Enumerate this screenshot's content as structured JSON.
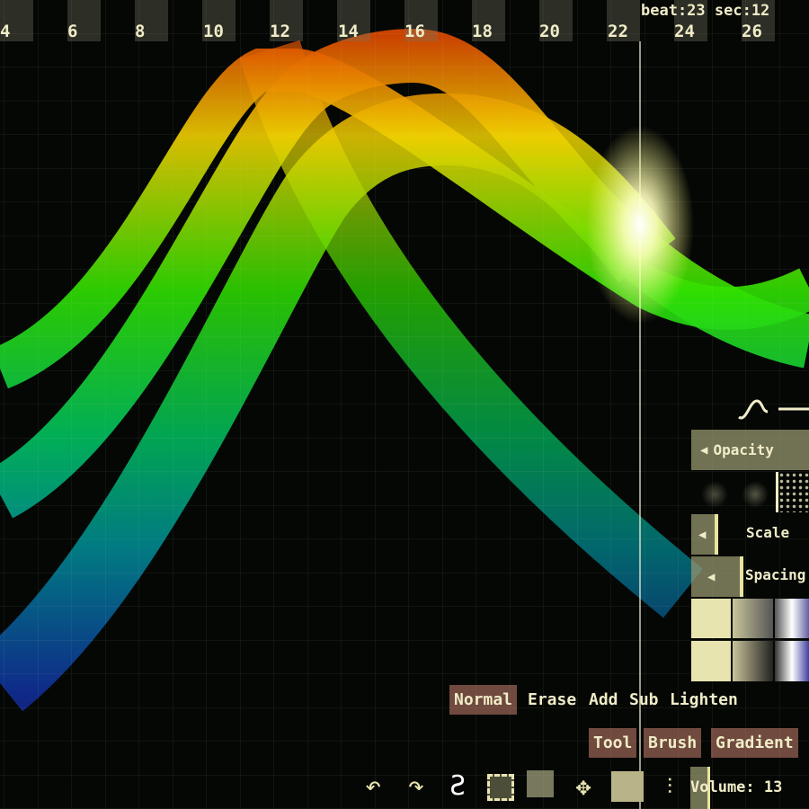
{
  "ruler": {
    "labels": [
      "4",
      "6",
      "8",
      "10",
      "12",
      "14",
      "16",
      "18",
      "20",
      "22",
      "24",
      "26"
    ],
    "beat_readout": "beat:23 sec:12"
  },
  "brush_panel": {
    "opacity_label": "Opacity",
    "scale_label": "Scale",
    "spacing_label": "Spacing"
  },
  "blend_modes": {
    "items": [
      "Normal",
      "Erase",
      "Add",
      "Sub",
      "Lighten"
    ],
    "selected": "Normal"
  },
  "tool_tabs": {
    "items": [
      "Tool",
      "Brush",
      "Gradient"
    ]
  },
  "toolbar": {
    "icons": [
      "undo-icon",
      "redo-icon",
      "smudge-icon",
      "select-rect-icon",
      "transform-icon",
      "move-icon",
      "save-icon",
      "mixer-icon"
    ],
    "volume_label": "Volume: 13"
  },
  "colors": {
    "background": "#050705",
    "text": "#f0ecc8",
    "button": "#969670",
    "selected": "#c8826e"
  }
}
